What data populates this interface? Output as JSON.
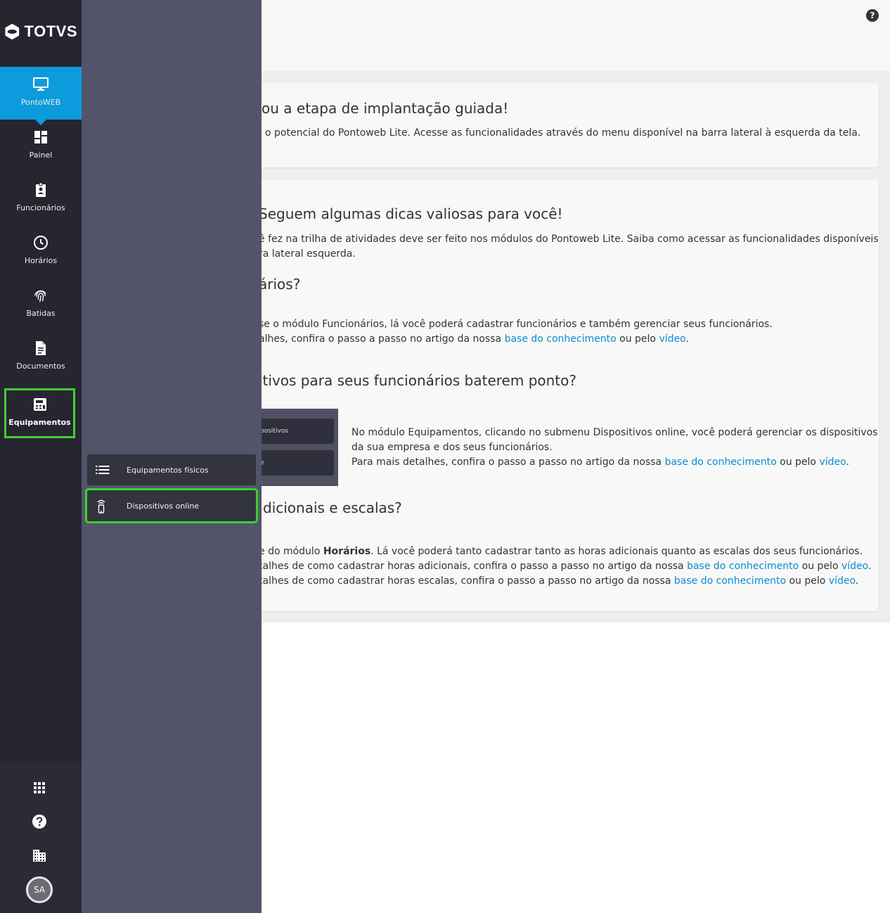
{
  "brand": {
    "name": "TOTVS"
  },
  "sidebar": {
    "items": [
      {
        "label": "PontoWEB",
        "icon": "monitor-icon"
      },
      {
        "label": "Painel",
        "icon": "dashboard-icon"
      },
      {
        "label": "Funcionários",
        "icon": "badge-icon"
      },
      {
        "label": "Horários",
        "icon": "clock-icon"
      },
      {
        "label": "Batidas",
        "icon": "fingerprint-icon"
      },
      {
        "label": "Documentos",
        "icon": "document-icon"
      },
      {
        "label": "Equipamentos",
        "icon": "equipment-icon"
      }
    ],
    "bottom": {
      "apps_icon": "apps-grid-icon",
      "help_icon": "help-icon",
      "company_icon": "building-icon",
      "avatar": "SA"
    },
    "active_color": "#0c9bdc",
    "highlight_color": "#3cd12b"
  },
  "submenu": {
    "items": [
      {
        "label": "Equipamentos físicos",
        "icon": "list-icon"
      },
      {
        "label": "Dispositivos online",
        "icon": "mobile-signal-icon"
      }
    ]
  },
  "main": {
    "help_icon": "?",
    "card1": {
      "title": "ou a etapa de implantação guiada!",
      "text": "o potencial do Pontoweb Lite. Acesse as funcionalidades através do menu disponível na barra lateral à esquerda da tela."
    },
    "card2": {
      "title": "Seguem algumas dicas valiosas para você!",
      "intro_1": "ê fez na trilha de atividades deve ser feito nos módulos do Pontoweb Lite. Saiba como acessar as funcionalidades disponíveis no",
      "intro_2": "ra lateral esquerda.",
      "s1_title": "ários?",
      "s1_line1": "se o módulo Funcionários, lá você poderá cadastrar funcionários e também gerenciar seus funcionários.",
      "s1_line2_pre": "alhes, confira o passo a passo no artigo da nossa ",
      "link_kb": "base do conhecimento",
      "or_by": " ou pelo ",
      "link_video": "vídeo",
      "dot": ".",
      "s2_title": "itivos para seus funcionários baterem ponto?",
      "thumb_btn1": "positivos",
      "thumb_btn2": "e",
      "s2_line1": "No módulo Equipamentos, clicando no submenu Dispositivos online, você poderá gerenciar os dispositivos",
      "s2_line2": "da sua empresa e dos seus funcionários.",
      "s2_line3_pre": "Para mais detalhes, confira o passo a passo no artigo da nossa ",
      "s3_title": "dicionais e escalas?",
      "s3_line1_pre": "e do módulo ",
      "s3_line1_bold": "Horários",
      "s3_line1_post": ". Lá você poderá tanto cadastrar tanto as horas adicionais quanto as escalas dos seus funcionários.",
      "s3_line2_pre": "talhes de como cadastrar horas adicionais, confira o passo a passo no artigo da nossa ",
      "s3_line3_pre": "talhes de como cadastrar horas escalas, confira o passo a passo no artigo da nossa "
    }
  }
}
